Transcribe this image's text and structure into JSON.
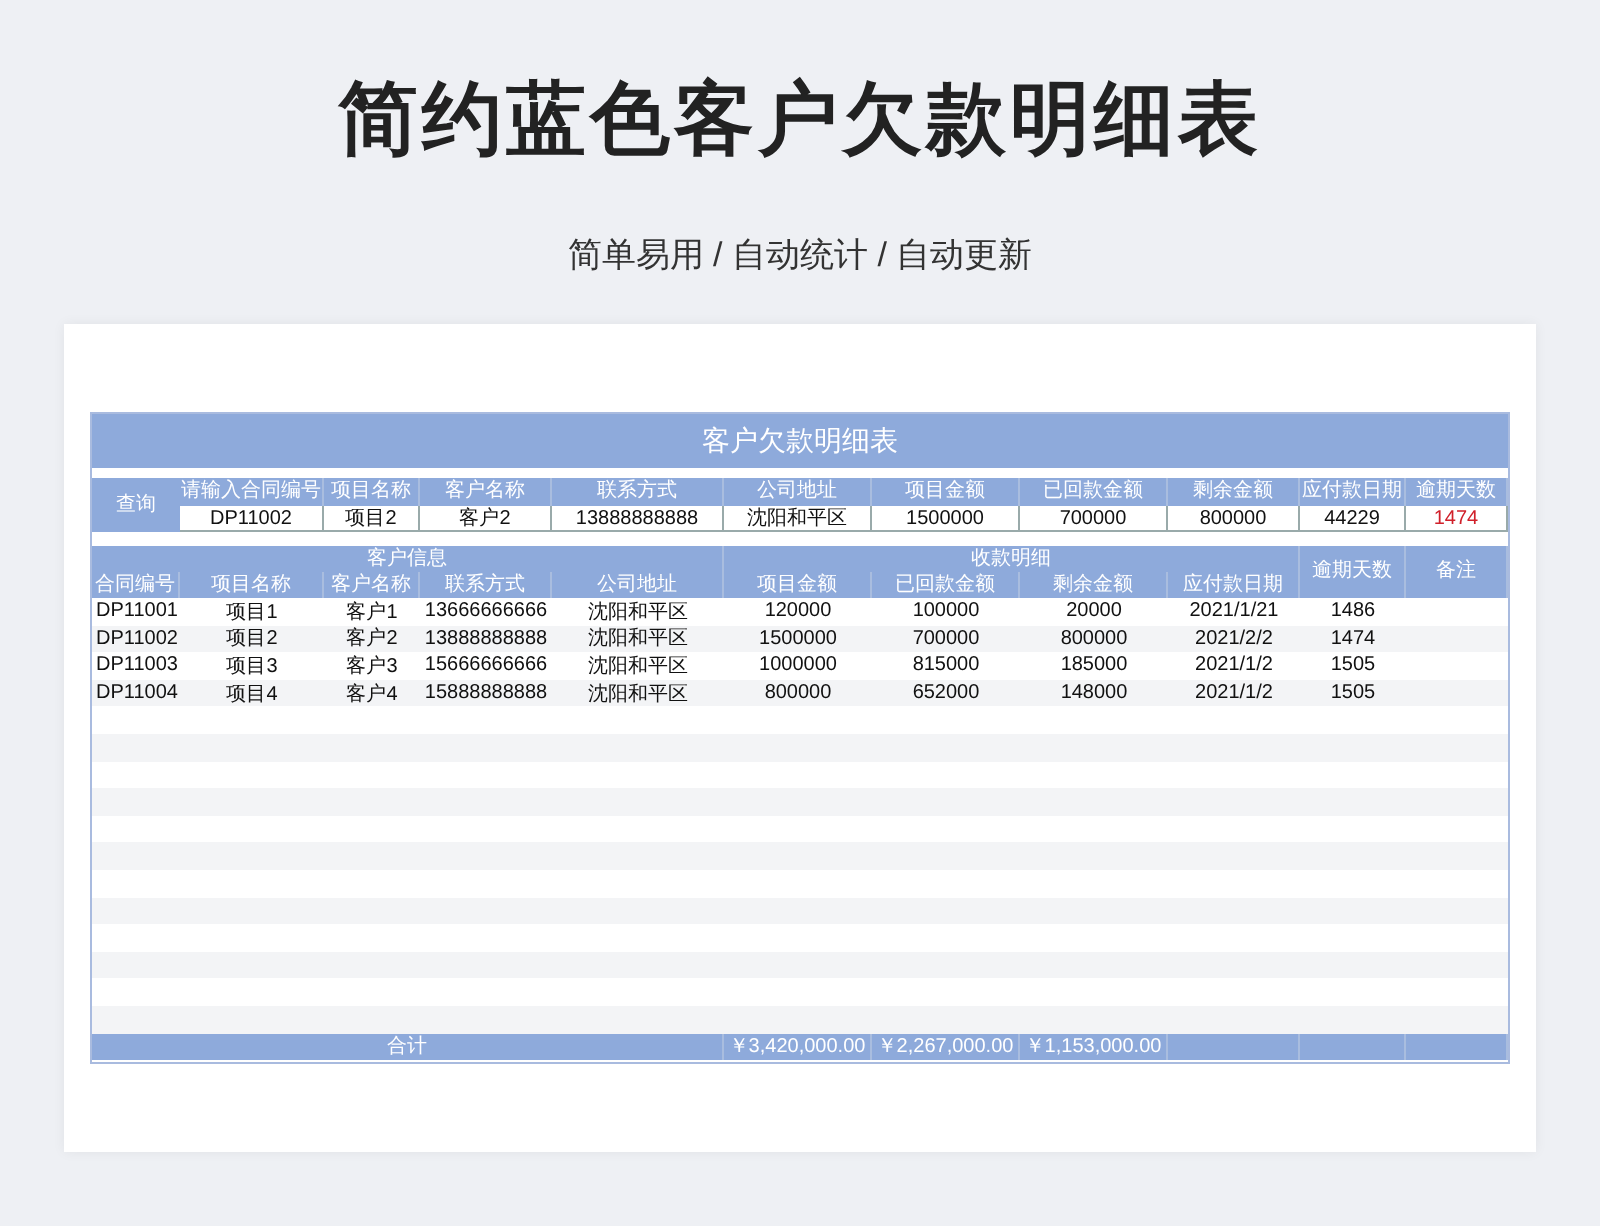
{
  "title": "简约蓝色客户欠款明细表",
  "subtitle": "简单易用 / 自动统计 / 自动更新",
  "sheet": {
    "title": "客户欠款明细表",
    "query": {
      "label": "查询",
      "fields": [
        {
          "label": "请输入合同编号",
          "value": "DP11002",
          "overdue": false
        },
        {
          "label": "项目名称",
          "value": "项目2",
          "overdue": false
        },
        {
          "label": "客户名称",
          "value": "客户2",
          "overdue": false
        },
        {
          "label": "联系方式",
          "value": "13888888888",
          "overdue": false
        },
        {
          "label": "公司地址",
          "value": "沈阳和平区",
          "overdue": false
        },
        {
          "label": "项目金额",
          "value": "1500000",
          "overdue": false
        },
        {
          "label": "已回款金额",
          "value": "700000",
          "overdue": false
        },
        {
          "label": "剩余金额",
          "value": "800000",
          "overdue": false
        },
        {
          "label": "应付款日期",
          "value": "44229",
          "overdue": false
        },
        {
          "label": "逾期天数",
          "value": "1474",
          "overdue": true
        }
      ]
    },
    "groups": [
      {
        "kind": "group",
        "label": "客户信息",
        "columns": [
          "合同编号",
          "项目名称",
          "客户名称",
          "联系方式",
          "公司地址"
        ]
      },
      {
        "kind": "group",
        "label": "收款明细",
        "columns": [
          "项目金额",
          "已回款金额",
          "剩余金额",
          "应付款日期"
        ]
      },
      {
        "kind": "single",
        "label": "逾期天数"
      },
      {
        "kind": "single",
        "label": "备注"
      }
    ],
    "rows": [
      [
        "DP11001",
        "项目1",
        "客户1",
        "13666666666",
        "沈阳和平区",
        "120000",
        "100000",
        "20000",
        "2021/1/21",
        "1486",
        ""
      ],
      [
        "DP11002",
        "项目2",
        "客户2",
        "13888888888",
        "沈阳和平区",
        "1500000",
        "700000",
        "800000",
        "2021/2/2",
        "1474",
        ""
      ],
      [
        "DP11003",
        "项目3",
        "客户3",
        "15666666666",
        "沈阳和平区",
        "1000000",
        "815000",
        "185000",
        "2021/1/2",
        "1505",
        ""
      ],
      [
        "DP11004",
        "项目4",
        "客户4",
        "15888888888",
        "沈阳和平区",
        "800000",
        "652000",
        "148000",
        "2021/1/2",
        "1505",
        ""
      ]
    ],
    "total": {
      "label": "合计",
      "values": [
        "￥3,420,000.00",
        "￥2,267,000.00",
        "￥1,153,000.00"
      ]
    }
  }
}
